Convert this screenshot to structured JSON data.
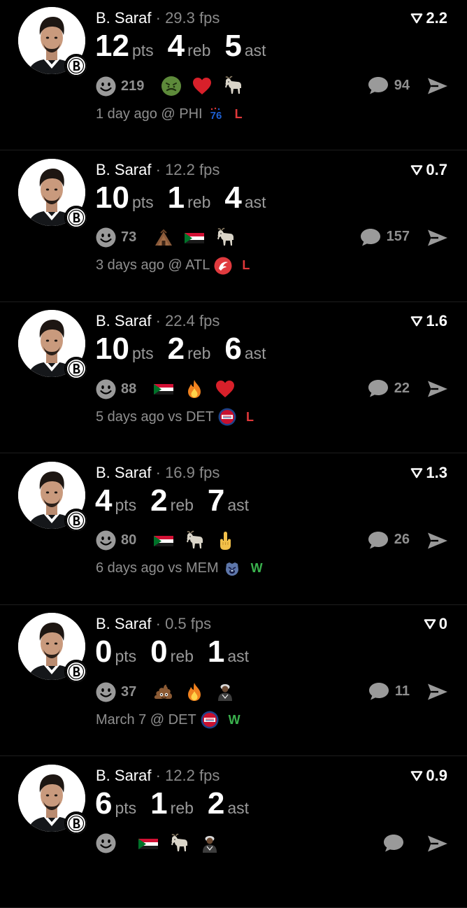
{
  "colors": {
    "background": "#000000",
    "muted_text": "#8f8f8f",
    "loss": "#e0383a",
    "win": "#3ab14d"
  },
  "labels": {
    "pts": "pts",
    "reb": "reb",
    "ast": "ast",
    "separator": "·"
  },
  "feed": [
    {
      "player": "B. Saraf",
      "fps": "29.3 fps",
      "rating": "2.2",
      "pts": "12",
      "reb": "4",
      "ast": "5",
      "smile_count": "219",
      "reactions": [
        "nauseated-face-icon",
        "red-heart-icon",
        "goat-icon"
      ],
      "comments": "94",
      "when": "1 day ago @ PHI",
      "opponent_logo": "sixers-logo",
      "result": "L"
    },
    {
      "player": "B. Saraf",
      "fps": "12.2 fps",
      "rating": "0.7",
      "pts": "10",
      "reb": "1",
      "ast": "4",
      "smile_count": "73",
      "reactions": [
        "hut-icon",
        "sudan-flag-icon",
        "goat-icon"
      ],
      "comments": "157",
      "when": "3 days ago @ ATL",
      "opponent_logo": "hawks-logo",
      "result": "L"
    },
    {
      "player": "B. Saraf",
      "fps": "22.4 fps",
      "rating": "1.6",
      "pts": "10",
      "reb": "2",
      "ast": "6",
      "smile_count": "88",
      "reactions": [
        "sudan-flag-icon",
        "fire-icon",
        "red-heart-icon"
      ],
      "comments": "22",
      "when": "5 days ago vs DET",
      "opponent_logo": "pistons-logo",
      "result": "L"
    },
    {
      "player": "B. Saraf",
      "fps": "16.9 fps",
      "rating": "1.3",
      "pts": "4",
      "reb": "2",
      "ast": "7",
      "smile_count": "80",
      "reactions": [
        "sudan-flag-icon",
        "goat-icon",
        "middle-finger-icon"
      ],
      "comments": "26",
      "when": "6 days ago vs MEM",
      "opponent_logo": "grizzlies-logo",
      "result": "W"
    },
    {
      "player": "B. Saraf",
      "fps": "0.5 fps",
      "rating": "0",
      "pts": "0",
      "reb": "0",
      "ast": "1",
      "smile_count": "37",
      "reactions": [
        "poop-icon",
        "fire-icon",
        "person-icon"
      ],
      "comments": "11",
      "when": "March 7 @ DET",
      "opponent_logo": "pistons-logo",
      "result": "W"
    },
    {
      "player": "B. Saraf",
      "fps": "12.2 fps",
      "rating": "0.9",
      "pts": "6",
      "reb": "1",
      "ast": "2",
      "smile_count": "",
      "reactions": [
        "sudan-flag-icon",
        "goat-icon",
        "person-icon"
      ],
      "comments": "",
      "when": "",
      "opponent_logo": "",
      "result": ""
    }
  ]
}
